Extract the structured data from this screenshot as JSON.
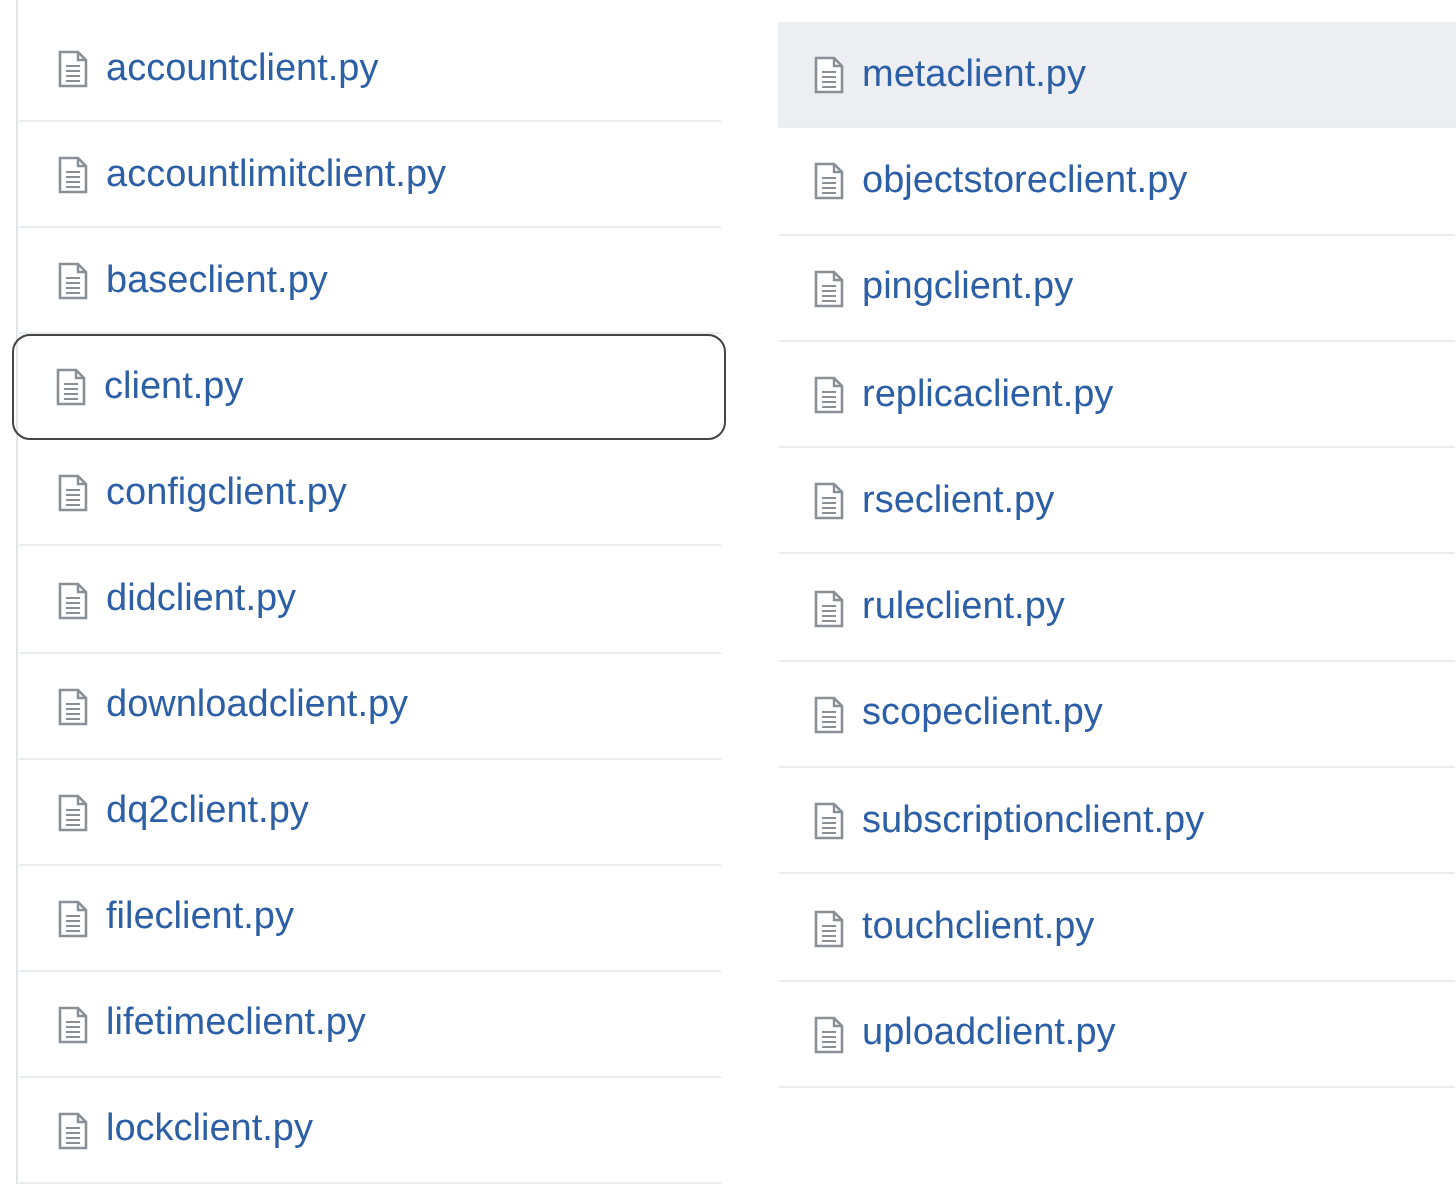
{
  "columns": [
    {
      "files": [
        {
          "name": "accountclient.py",
          "selected": false,
          "highlighted": false
        },
        {
          "name": "accountlimitclient.py",
          "selected": false,
          "highlighted": false
        },
        {
          "name": "baseclient.py",
          "selected": false,
          "highlighted": false
        },
        {
          "name": "client.py",
          "selected": true,
          "highlighted": false
        },
        {
          "name": "configclient.py",
          "selected": false,
          "highlighted": false
        },
        {
          "name": "didclient.py",
          "selected": false,
          "highlighted": false
        },
        {
          "name": "downloadclient.py",
          "selected": false,
          "highlighted": false
        },
        {
          "name": "dq2client.py",
          "selected": false,
          "highlighted": false
        },
        {
          "name": "fileclient.py",
          "selected": false,
          "highlighted": false
        },
        {
          "name": "lifetimeclient.py",
          "selected": false,
          "highlighted": false
        },
        {
          "name": "lockclient.py",
          "selected": false,
          "highlighted": false
        }
      ]
    },
    {
      "files": [
        {
          "name": "metaclient.py",
          "selected": false,
          "highlighted": true
        },
        {
          "name": "objectstoreclient.py",
          "selected": false,
          "highlighted": false
        },
        {
          "name": "pingclient.py",
          "selected": false,
          "highlighted": false
        },
        {
          "name": "replicaclient.py",
          "selected": false,
          "highlighted": false
        },
        {
          "name": "rseclient.py",
          "selected": false,
          "highlighted": false
        },
        {
          "name": "ruleclient.py",
          "selected": false,
          "highlighted": false
        },
        {
          "name": "scopeclient.py",
          "selected": false,
          "highlighted": false
        },
        {
          "name": "subscriptionclient.py",
          "selected": false,
          "highlighted": false
        },
        {
          "name": "touchclient.py",
          "selected": false,
          "highlighted": false
        },
        {
          "name": "uploadclient.py",
          "selected": false,
          "highlighted": false
        }
      ]
    }
  ]
}
